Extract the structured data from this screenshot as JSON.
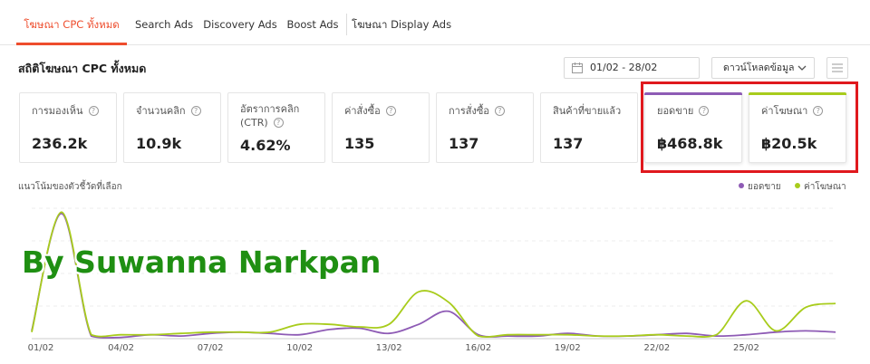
{
  "tabs": [
    {
      "label": "โฆษณา CPC ทั้งหมด",
      "active": true
    },
    {
      "label": "Search Ads",
      "active": false
    },
    {
      "label": "Discovery Ads",
      "active": false
    },
    {
      "label": "Boost Ads",
      "active": false
    },
    {
      "label": "โฆษณา Display Ads",
      "active": false
    }
  ],
  "header": {
    "title": "สถิติโฆษณา CPC ทั้งหมด",
    "date_range": "01/02 - 28/02",
    "download_label": "ดาวน์โหลดข้อมูล"
  },
  "metrics": [
    {
      "label": "การมองเห็น",
      "value": "236.2k"
    },
    {
      "label": "จำนวนคลิก",
      "value": "10.9k"
    },
    {
      "label": "อัตราการคลิก (CTR)",
      "label_line1": "อัตราการคลิก",
      "label_line2": "(CTR)",
      "value": "4.62%"
    },
    {
      "label": "ค่าสั่งซื้อ",
      "value": "135"
    },
    {
      "label": "การสั่งซื้อ",
      "value": "137"
    },
    {
      "label": "สินค้าที่ขายแล้ว",
      "value": "137"
    },
    {
      "label": "ยอดขาย",
      "value": "฿468.8k",
      "selected": true,
      "accent": "#8e5bb5"
    },
    {
      "label": "ค่าโฆษณา",
      "value": "฿20.5k",
      "selected": true,
      "accent": "#a8cc1c"
    }
  ],
  "chart_title": "แนวโน้มของตัวชี้วัดที่เลือก",
  "watermark": "By Suwanna Narkpan",
  "colors": {
    "accent": "#ee4d2d",
    "sales": "#8e5bb5",
    "ad_cost": "#a8cc1c",
    "highlight": "#e0191e"
  },
  "chart_data": {
    "type": "line",
    "x_tick_labels": [
      "01/02",
      "04/02",
      "07/02",
      "10/02",
      "13/02",
      "16/02",
      "19/02",
      "22/02",
      "25/02"
    ],
    "x": [
      1,
      2,
      3,
      4,
      5,
      6,
      7,
      8,
      9,
      10,
      11,
      12,
      13,
      14,
      15,
      16,
      17,
      18,
      19,
      20,
      21,
      22,
      23,
      24,
      25,
      26,
      27,
      28
    ],
    "series": [
      {
        "name": "ยอดขาย",
        "color": "#8e5bb5",
        "values": [
          0.06,
          0.96,
          0.02,
          0.01,
          0.03,
          0.02,
          0.04,
          0.05,
          0.04,
          0.03,
          0.07,
          0.08,
          0.04,
          0.11,
          0.21,
          0.03,
          0.02,
          0.02,
          0.04,
          0.02,
          0.02,
          0.03,
          0.04,
          0.02,
          0.03,
          0.05,
          0.06,
          0.05
        ]
      },
      {
        "name": "ค่าโฆษณา",
        "color": "#a8cc1c",
        "values": [
          0.05,
          0.97,
          0.03,
          0.03,
          0.03,
          0.04,
          0.05,
          0.05,
          0.05,
          0.11,
          0.11,
          0.09,
          0.11,
          0.36,
          0.28,
          0.02,
          0.03,
          0.03,
          0.03,
          0.02,
          0.02,
          0.03,
          0.02,
          0.03,
          0.29,
          0.06,
          0.24,
          0.27
        ]
      }
    ],
    "ylim": [
      0,
      1
    ],
    "grid": true,
    "legend_position": "top-right"
  }
}
